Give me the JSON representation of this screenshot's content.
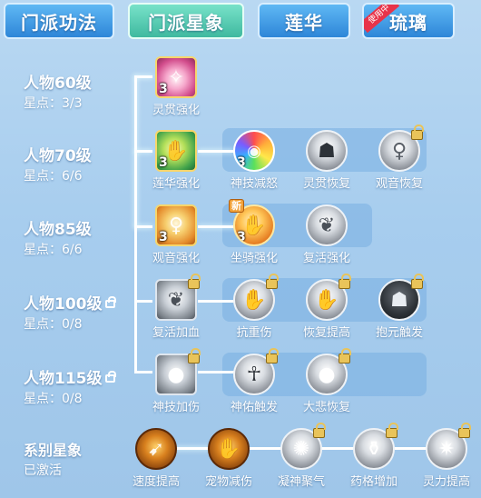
{
  "tabs": [
    {
      "label": "门派功法"
    },
    {
      "label": "门派星象"
    },
    {
      "label": "莲华"
    },
    {
      "label": "琉璃",
      "ribbon": "使用中"
    }
  ],
  "tiers": [
    {
      "title": "人物60级",
      "stars": "星点：3/3",
      "locked": false
    },
    {
      "title": "人物70级",
      "stars": "星点：6/6",
      "locked": false
    },
    {
      "title": "人物85级",
      "stars": "星点：6/6",
      "locked": false
    },
    {
      "title": "人物100级",
      "stars": "星点：0/8",
      "locked": true
    },
    {
      "title": "人物115级",
      "stars": "星点：0/8",
      "locked": true
    }
  ],
  "skills": {
    "r1": [
      {
        "name": "灵贯强化",
        "level": "3",
        "icon": "glowing-figure-icon"
      }
    ],
    "r2": [
      {
        "name": "莲华强化",
        "level": "3",
        "icon": "hand-lotus-icon"
      },
      {
        "name": "神技减怒",
        "level": "3",
        "icon": "rage-meter-icon"
      },
      {
        "name": "灵贯恢复",
        "level": "",
        "icon": "meditating-figure-icon"
      },
      {
        "name": "观音恢复",
        "level": "",
        "icon": "guanyin-icon",
        "locked": true
      }
    ],
    "r3": [
      {
        "name": "观音强化",
        "level": "3",
        "icon": "guanyin-icon"
      },
      {
        "name": "坐骑强化",
        "level": "3",
        "icon": "hand-orb-icon",
        "badge": "新"
      },
      {
        "name": "复活强化",
        "level": "",
        "icon": "feather-hand-icon"
      }
    ],
    "r4": [
      {
        "name": "复活加血",
        "level": "",
        "icon": "feather-hand-icon",
        "locked": true
      },
      {
        "name": "抗重伤",
        "level": "",
        "icon": "open-hand-icon",
        "locked": true
      },
      {
        "name": "恢复提高",
        "level": "",
        "icon": "hand-orb-icon",
        "locked": true
      },
      {
        "name": "抱元触发",
        "level": "",
        "icon": "meditating-figure-icon",
        "locked": true
      }
    ],
    "r5": [
      {
        "name": "神技加伤",
        "level": "",
        "icon": "light-orb-icon",
        "locked": true
      },
      {
        "name": "神佑触发",
        "level": "",
        "icon": "standing-figure-icon",
        "locked": true
      },
      {
        "name": "大悲恢复",
        "level": "",
        "icon": "light-orb-icon",
        "locked": true
      }
    ]
  },
  "series": {
    "title": "系别星象",
    "status": "已激活",
    "items": [
      {
        "name": "速度提高",
        "icon": "speed-icon"
      },
      {
        "name": "宠物减伤",
        "icon": "pet-shield-icon"
      },
      {
        "name": "凝神聚气",
        "icon": "focus-icon",
        "locked": true
      },
      {
        "name": "药格增加",
        "icon": "medicine-icon",
        "locked": true
      },
      {
        "name": "灵力提高",
        "icon": "spirit-icon",
        "locked": true
      }
    ]
  }
}
